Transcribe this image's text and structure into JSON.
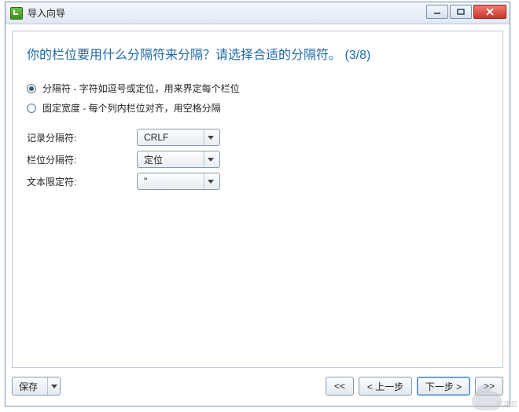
{
  "window": {
    "title": "导入向导"
  },
  "heading": "你的栏位要用什么分隔符来分隔？请选择合适的分隔符。 (3/8)",
  "radios": {
    "delimited": {
      "label": "分隔符 - 字符如逗号或定位，用来界定每个栏位",
      "checked": true
    },
    "fixed": {
      "label": "固定宽度 - 每个列内栏位对齐，用空格分隔",
      "checked": false
    }
  },
  "fields": {
    "record_sep": {
      "label": "记录分隔符:",
      "value": "CRLF"
    },
    "field_sep": {
      "label": "栏位分隔符:",
      "value": "定位"
    },
    "text_qual": {
      "label": "文本限定符:",
      "value": "\""
    }
  },
  "footer": {
    "save": "保存",
    "first": "<<",
    "prev": "< 上一步",
    "next": "下一步 >",
    "last": ">>"
  },
  "watermark": "亿速云"
}
